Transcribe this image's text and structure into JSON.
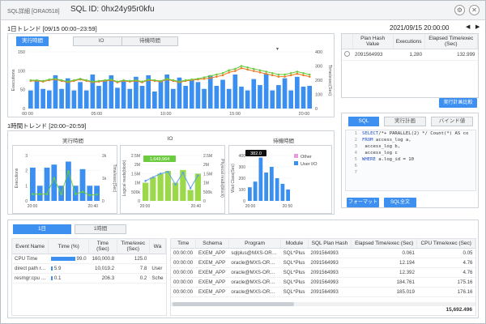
{
  "window": {
    "app": "SQL詳細 [ORA0518]",
    "title": "SQL ID: 0hx24y95r0kfu"
  },
  "header": {
    "daily_label": "1日トレンド [09/15 00:00~23:59]",
    "datetime": "2021/09/15 20:00:00",
    "hourly_label": "1時間トレンド [20:00~20:59]"
  },
  "top_tabs": [
    "実行時間",
    "IO",
    "待機時間"
  ],
  "plan_table": {
    "headers": [
      "Plan Hash Value",
      "Executions",
      "Elapsed Time/exec (Sec)"
    ],
    "row": [
      "2091564993",
      "1,280",
      "132.999"
    ]
  },
  "plan_button": "実行計画比較",
  "sql_tabs": [
    "SQL",
    "実行計画",
    "バインド値"
  ],
  "sql_lines": [
    {
      "n": "1",
      "kw": "SELECT",
      "rest": "/*+ PARALLEL(2) */ Count(*) AS co"
    },
    {
      "n": "2",
      "kw": "FROM",
      "rest": "  access_log a,"
    },
    {
      "n": "3",
      "kw": "",
      "rest": "       access_log b,"
    },
    {
      "n": "4",
      "kw": "",
      "rest": "       access_log c"
    },
    {
      "n": "5",
      "kw": "WHERE",
      "rest": " a.log_id = 10"
    },
    {
      "n": "6",
      "kw": "",
      "rest": ""
    },
    {
      "n": "7",
      "kw": "",
      "rest": ""
    }
  ],
  "sql_buttons": [
    "フォーマット",
    "SQL全文"
  ],
  "mini_titles": [
    "実行時間",
    "IO",
    "待機時間"
  ],
  "io_tooltip": "1,649,964",
  "wait_tooltip": "382.0",
  "wait_legend": [
    "Other",
    "User I/O"
  ],
  "bottom_tabs": [
    "1日",
    "1時間"
  ],
  "event_table": {
    "headers": [
      "Event Name",
      "Time (%)",
      "Time (Sec)",
      "Time/exec (Sec)",
      "Wa"
    ],
    "rows": [
      [
        "CPU Time",
        "99.0",
        "160,000.8",
        "125.0",
        ""
      ],
      [
        "direct path r…",
        "5.9",
        "10,019.2",
        "7.8",
        "User"
      ],
      [
        "resmgr:cpu …",
        "0.1",
        "206.3",
        "0.2",
        "Sche"
      ]
    ]
  },
  "session_table": {
    "headers": [
      "Time",
      "Schema",
      "Program",
      "Module",
      "SQL Plan Hash",
      "Elapsed Time/exec (Sec)",
      "CPU Time/exec (Sec)"
    ],
    "rows": [
      [
        "00:00:00",
        "EXEM_APP",
        "sqlplus@MXS-OR…",
        "SQL*Plus",
        "2091564993",
        "0.061",
        "0.05"
      ],
      [
        "00:00:00",
        "EXEM_APP",
        "oracle@MXS-OR…",
        "SQL*Plus",
        "2091564993",
        "12.194",
        "4.76"
      ],
      [
        "00:00:00",
        "EXEM_APP",
        "oracle@MXS-OR…",
        "SQL*Plus",
        "2091564993",
        "12.392",
        "4.76"
      ],
      [
        "00:00:00",
        "EXEM_APP",
        "oracle@MXS-OR…",
        "SQL*Plus",
        "2091564993",
        "184.761",
        "175.16"
      ],
      [
        "00:00:00",
        "EXEM_APP",
        "oracle@MXS-OR…",
        "SQL*Plus",
        "2091564993",
        "185.019",
        "176.16"
      ]
    ],
    "total": "15,692.496"
  },
  "colors": {
    "accent": "#3d8ff0",
    "bar": "#3a8ff0",
    "line_green": "#6ccb3e",
    "line_orange": "#f07a2a",
    "bar_light_green": "#9bd94a",
    "legend_other": "#e89bd8"
  },
  "chart_data": [
    {
      "type": "bar",
      "title": "1日トレンド",
      "ylabel": "Executions",
      "y2label": "Time/exec(Sec)",
      "xticks": [
        "00:00",
        "05:00",
        "10:00",
        "15:00",
        "20:00"
      ],
      "yticks": [
        "150",
        "100",
        "50",
        "0"
      ],
      "y2ticks": [
        "400",
        "300",
        "200",
        "100",
        "0"
      ],
      "ylim": [
        0,
        150
      ],
      "y2lim": [
        0,
        400
      ],
      "series": [
        {
          "values": [
            48,
            75,
            52,
            48,
            88,
            52,
            80,
            48,
            70,
            48,
            90,
            60,
            75,
            88,
            55,
            72,
            52,
            84,
            60,
            88,
            45,
            72,
            90,
            52,
            82,
            60,
            75,
            70,
            52,
            88,
            60,
            76,
            52,
            90,
            58,
            48,
            78,
            62,
            92,
            48,
            62,
            80,
            48,
            84,
            58,
            60
          ]
        },
        {
          "values": [
            200,
            200,
            195,
            205,
            210,
            200,
            190,
            200,
            210,
            200,
            190,
            195,
            200,
            205,
            190,
            200,
            195,
            200,
            190,
            205,
            200,
            195,
            210,
            200,
            190,
            200,
            205,
            210,
            220,
            230,
            240,
            250,
            270,
            280,
            300,
            290,
            280,
            270,
            260,
            250,
            240,
            240,
            250,
            260,
            250,
            240
          ]
        },
        {
          "values": [
            195,
            195,
            190,
            200,
            205,
            195,
            185,
            195,
            205,
            195,
            185,
            190,
            195,
            200,
            185,
            195,
            190,
            195,
            185,
            200,
            195,
            190,
            205,
            195,
            185,
            195,
            200,
            205,
            210,
            215,
            225,
            235,
            255,
            265,
            285,
            275,
            265,
            255,
            245,
            235,
            225,
            225,
            235,
            245,
            235,
            225
          ]
        }
      ]
    },
    {
      "type": "bar",
      "title": "実行時間",
      "ylabel": "Executions",
      "y2label": "Time/exec(Sec)",
      "xticks": [
        "20:00",
        "20:40"
      ],
      "yticks": [
        "3",
        "2",
        "1",
        "0"
      ],
      "y2ticks": [
        "2k",
        "1k",
        "0"
      ],
      "ylim": [
        0,
        3
      ],
      "y2lim": [
        0,
        2000
      ],
      "series": [
        {
          "values": [
            2.2,
            1.0,
            2.2,
            2.4,
            1.0,
            2.6,
            1.0,
            2.1,
            1.0,
            1.0
          ]
        },
        {
          "values": [
            300,
            300,
            300,
            1000,
            300,
            1300,
            300,
            400,
            250,
            280
          ]
        }
      ]
    },
    {
      "type": "bar",
      "title": "IO",
      "ylabel": "Logical reads(block)",
      "y2label": "Physical reads(block)",
      "xticks": [
        "20:00",
        "20:40"
      ],
      "yticks": [
        "2.5M",
        "2M",
        "1.5M",
        "1M",
        "500k",
        "0"
      ],
      "y2ticks": [
        "2.5M",
        "2M",
        "1.5M",
        "1M",
        "500k",
        "0"
      ],
      "ylim": [
        0,
        2500000
      ],
      "y2lim": [
        0,
        2500000
      ],
      "series": [
        {
          "values": [
            1000000,
            1300000,
            1500000,
            1649964,
            1000000,
            1700000,
            600000,
            1500000
          ]
        },
        {
          "values": [
            1100000,
            1300000,
            1500000,
            1600000,
            900000,
            1550000,
            700000,
            1400000
          ]
        }
      ]
    },
    {
      "type": "bar",
      "title": "待機時間",
      "ylabel": "Wait Class(Sec)",
      "xticks": [
        "20:00",
        "20:50"
      ],
      "yticks": [
        "400",
        "300",
        "200",
        "100",
        "0"
      ],
      "ylim": [
        0,
        400
      ],
      "series": [
        {
          "name": "Other",
          "values": [
            0,
            0,
            0,
            0,
            0,
            0,
            0,
            0
          ]
        },
        {
          "name": "User I/O",
          "values": [
            120,
            170,
            382,
            250,
            300,
            200,
            150,
            100
          ]
        }
      ]
    }
  ]
}
